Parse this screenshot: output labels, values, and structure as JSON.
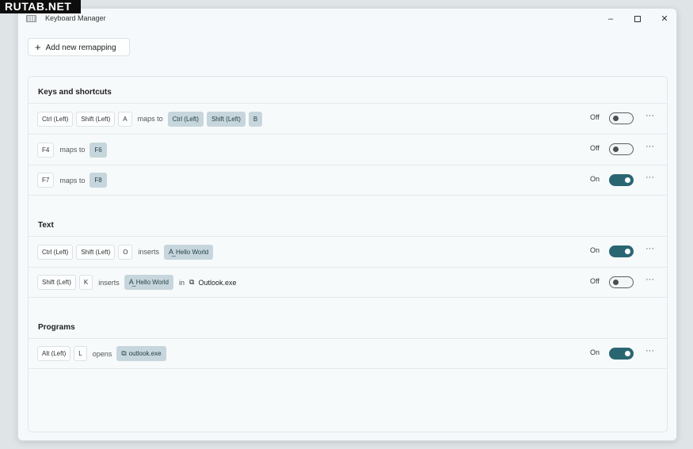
{
  "watermark": "RUTAB.NET",
  "window": {
    "title": "Keyboard Manager",
    "minimize": "–",
    "close": "✕"
  },
  "add_button": {
    "icon": "+",
    "label": "Add new remapping"
  },
  "sections": {
    "keys": {
      "title": "Keys and shortcuts",
      "rows": [
        {
          "keys": [
            "Ctrl (Left)",
            "Shift (Left)",
            "A"
          ],
          "verb": "maps to",
          "targets": [
            "Ctrl (Left)",
            "Shift (Left)",
            "B"
          ],
          "state": "Off"
        },
        {
          "keys": [
            "F4"
          ],
          "verb": "maps to",
          "targets": [
            "F6"
          ],
          "state": "Off"
        },
        {
          "keys": [
            "F7"
          ],
          "verb": "maps to",
          "targets": [
            "F8"
          ],
          "state": "On"
        }
      ]
    },
    "text": {
      "title": "Text",
      "rows": [
        {
          "keys": [
            "Ctrl (Left)",
            "Shift (Left)",
            "O"
          ],
          "verb": "inserts",
          "text": "Hello World",
          "state": "On"
        },
        {
          "keys": [
            "Shift (Left)",
            "K"
          ],
          "verb": "inserts",
          "text": "Hello World",
          "in": "in",
          "app": "Outlook.exe",
          "state": "Off"
        }
      ]
    },
    "programs": {
      "title": "Programs",
      "rows": [
        {
          "keys": [
            "Alt (Left)",
            "L"
          ],
          "verb": "opens",
          "program": "outlook.exe",
          "state": "On"
        }
      ]
    }
  },
  "more_glyph": "···",
  "text_icon": "A͢",
  "app_icon": "⧉",
  "colors": {
    "toggle_on": "#2a6672",
    "key_target_bg": "#c6d6dc"
  }
}
